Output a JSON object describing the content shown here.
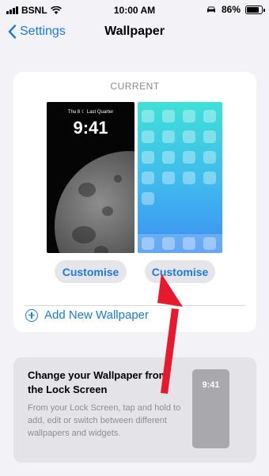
{
  "status_bar": {
    "carrier": "BSNL",
    "time": "10:00 AM",
    "battery": "86%",
    "battery_level": 0.86
  },
  "nav": {
    "back_label": "Settings",
    "title": "Wallpaper"
  },
  "current_section": {
    "label": "CURRENT",
    "lock_screen": {
      "date_text": "Thu 8  ☾ Last Quarter",
      "time": "9:41"
    },
    "customise_left": "Customise",
    "customise_right": "Customise",
    "add_new_label": "Add New Wallpaper"
  },
  "tip_card": {
    "title": "Change your Wallpaper from the Lock Screen",
    "body": "From your Lock Screen, tap and hold to add, edit or switch between different wallpapers and widgets.",
    "preview_time": "9:41"
  },
  "colors": {
    "accent": "#1a7ae0",
    "annotation_arrow": "#e8192c"
  }
}
